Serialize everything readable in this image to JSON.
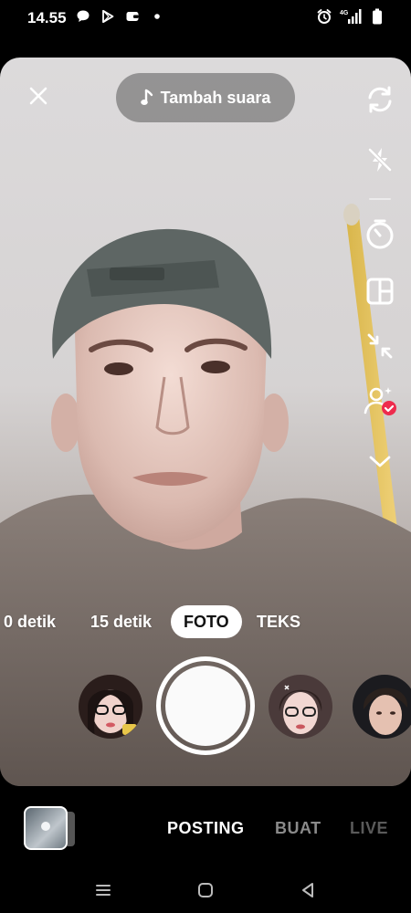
{
  "status_bar": {
    "time": "14.55",
    "left_icons": [
      "chat-bubble-icon",
      "play-store-icon",
      "wallet-icon",
      "dot-icon"
    ],
    "right_icons": [
      "alarm-icon",
      "4g-signal-icon",
      "battery-icon"
    ],
    "network_label": "4G"
  },
  "camera": {
    "close_icon": "close-icon",
    "add_sound_label": "Tambah suara",
    "tools": [
      "flip-camera-icon",
      "flash-off-icon",
      "timer-icon",
      "layout-icon",
      "collapse-icon",
      "beauty-check-icon",
      "chevron-down-icon"
    ]
  },
  "modes": {
    "items": [
      "0 detik",
      "15 detik",
      "FOTO",
      "TEKS"
    ],
    "active": "FOTO"
  },
  "effects": [
    "effect-glasses-girl",
    "effect-glasses-girl-2",
    "effect-boy-portrait"
  ],
  "bottom_nav": {
    "items": [
      "POSTING",
      "BUAT",
      "LIVE"
    ],
    "active": "POSTING"
  },
  "system_nav": [
    "recent-apps-icon",
    "home-icon",
    "back-icon"
  ],
  "colors": {
    "badge_red": "#ee2b4d",
    "pill_bg": "#5a5a5a",
    "inactive_nav": "#8a8a8a"
  }
}
